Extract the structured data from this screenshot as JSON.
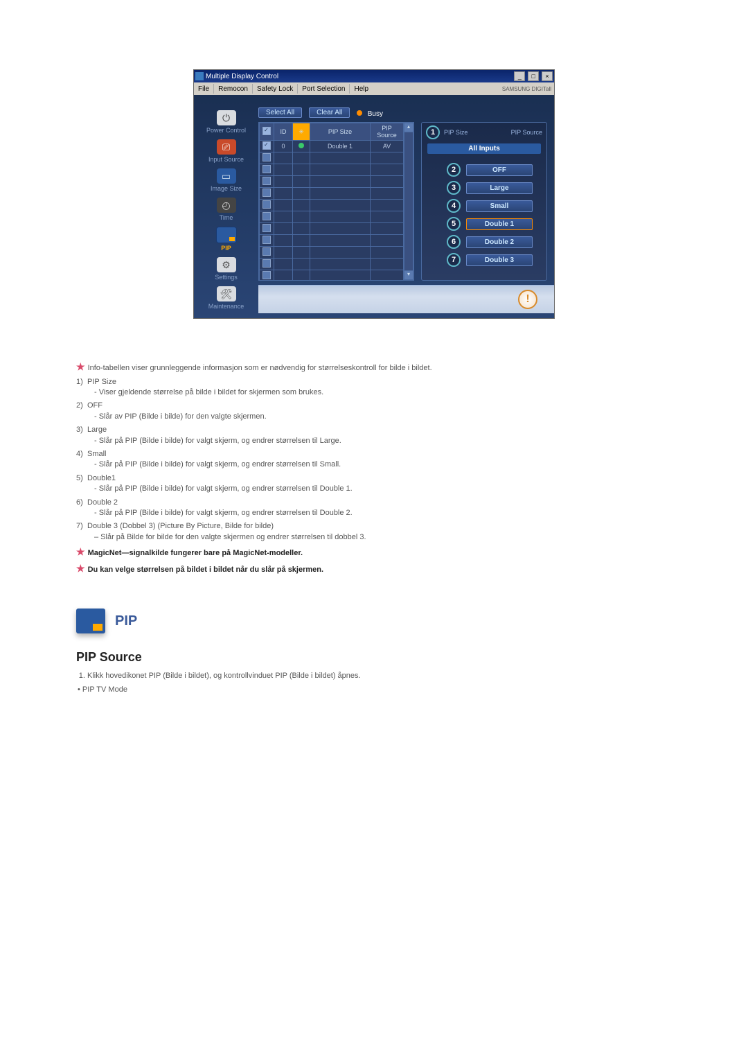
{
  "window": {
    "title": "Multiple Display Control",
    "brand": "SAMSUNG DIGITall"
  },
  "menubar": [
    "File",
    "Remocon",
    "Safety Lock",
    "Port Selection",
    "Help"
  ],
  "sidebar": {
    "items": [
      {
        "label": "Power Control"
      },
      {
        "label": "Input Source"
      },
      {
        "label": "Image Size"
      },
      {
        "label": "Time"
      },
      {
        "label": "PIP"
      },
      {
        "label": "Settings"
      },
      {
        "label": "Maintenance"
      }
    ]
  },
  "toolbar": {
    "select_all": "Select All",
    "clear_all": "Clear All",
    "busy": "Busy"
  },
  "table": {
    "headers": {
      "id": "ID",
      "pipsize": "PIP Size",
      "pipsource": "PIP Source"
    },
    "row": {
      "id": "0",
      "pipsize": "Double 1",
      "pipsource": "AV"
    }
  },
  "panel": {
    "h_left": "PIP Size",
    "h_right": "PIP Source",
    "subhead": "All Inputs",
    "options": [
      {
        "num": "2",
        "label": "OFF"
      },
      {
        "num": "3",
        "label": "Large"
      },
      {
        "num": "4",
        "label": "Small"
      },
      {
        "num": "5",
        "label": "Double 1"
      },
      {
        "num": "6",
        "label": "Double 2"
      },
      {
        "num": "7",
        "label": "Double 3"
      }
    ],
    "callout_num": "1"
  },
  "text": {
    "intro": "Info-tabellen viser grunnleggende informasjon som er nødvendig for størrelseskontroll for bilde i bildet.",
    "items": [
      {
        "n": "1)",
        "t": "PIP Size",
        "d": "- Viser gjeldende størrelse på bilde i bildet for skjermen som brukes."
      },
      {
        "n": "2)",
        "t": "OFF",
        "d": "- Slår av PIP (Bilde i bilde) for den valgte skjermen."
      },
      {
        "n": "3)",
        "t": "Large",
        "d": "- Slår på PIP (Bilde i bilde) for valgt skjerm, og endrer størrelsen til Large."
      },
      {
        "n": "4)",
        "t": "Small",
        "d": "- Slår på PIP (Bilde i bilde) for valgt skjerm, og endrer størrelsen til Small."
      },
      {
        "n": "5)",
        "t": "Double1",
        "d": "- Slår på PIP (Bilde i bilde) for valgt skjerm, og endrer størrelsen til Double 1."
      },
      {
        "n": "6)",
        "t": "Double 2",
        "d": "- Slår på PIP (Bilde i bilde) for valgt skjerm, og endrer størrelsen til Double 2."
      },
      {
        "n": "7)",
        "t": "Double 3 (Dobbel 3) (Picture By Picture, Bilde for bilde)",
        "d": "– Slår på Bilde for bilde for den valgte skjermen og endrer størrelsen til dobbel 3."
      }
    ],
    "note1": "MagicNet—signalkilde fungerer bare på MagicNet-modeller.",
    "note2": "Du kan velge størrelsen på bildet i bildet når du slår på skjermen.",
    "pip_heading": "PIP",
    "section_heading": "PIP Source",
    "step1": "Klikk hovedikonet PIP (Bilde i bildet), og kontrollvinduet PIP (Bilde i bildet) åpnes.",
    "bullet1": "PIP TV Mode"
  }
}
